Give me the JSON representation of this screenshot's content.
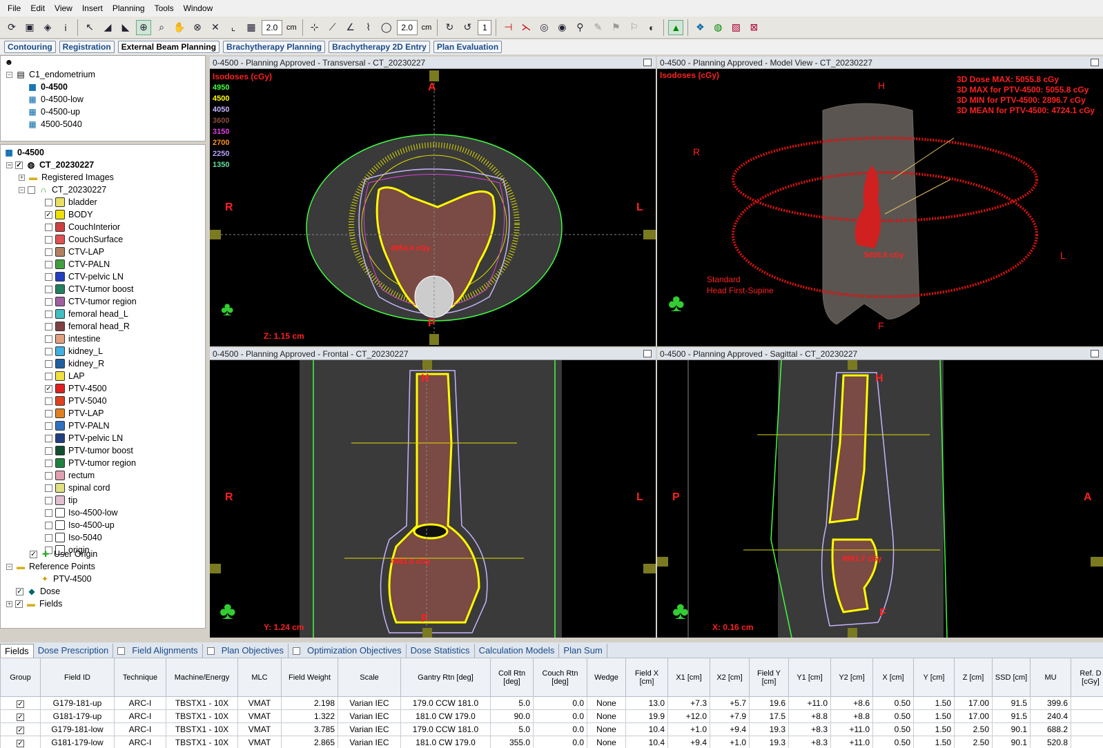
{
  "menu": [
    "File",
    "Edit",
    "View",
    "Insert",
    "Planning",
    "Tools",
    "Window"
  ],
  "toolbar": {
    "zoom_value_1": "2.0",
    "unit_1": "cm",
    "zoom_value_2": "2.0",
    "unit_2": "cm",
    "slice_value": "1"
  },
  "workspace_tabs": [
    "Contouring",
    "Registration",
    "External Beam Planning",
    "Brachytherapy Planning",
    "Brachytherapy 2D Entry",
    "Plan Evaluation"
  ],
  "plan_tree": {
    "course": "C1_endometrium",
    "plans": [
      "0-4500",
      "0-4500-low",
      "0-4500-up",
      "4500-5040"
    ],
    "active_plan": "0-4500"
  },
  "scope_tree": {
    "root": "0-4500",
    "image": "CT_20230227",
    "registered": "Registered Images",
    "structure_set": "CT_20230227",
    "structures": [
      {
        "name": "bladder",
        "checked": false,
        "color": "#e8e060"
      },
      {
        "name": "BODY",
        "checked": true,
        "color": "#f0e000"
      },
      {
        "name": "CouchInterior",
        "checked": false,
        "color": "#d04040"
      },
      {
        "name": "CouchSurface",
        "checked": false,
        "color": "#e05050"
      },
      {
        "name": "CTV-LAP",
        "checked": false,
        "color": "#b08060"
      },
      {
        "name": "CTV-PALN",
        "checked": false,
        "color": "#40a040"
      },
      {
        "name": "CTV-pelvic LN",
        "checked": false,
        "color": "#2040c0"
      },
      {
        "name": "CTV-tumor boost",
        "checked": false,
        "color": "#208060"
      },
      {
        "name": "CTV-tumor region",
        "checked": false,
        "color": "#a060a0"
      },
      {
        "name": "femoral head_L",
        "checked": false,
        "color": "#40c0c0"
      },
      {
        "name": "femoral head_R",
        "checked": false,
        "color": "#804040"
      },
      {
        "name": "intestine",
        "checked": false,
        "color": "#e0a080"
      },
      {
        "name": "kidney_L",
        "checked": false,
        "color": "#40b0e0"
      },
      {
        "name": "kidney_R",
        "checked": false,
        "color": "#2060a0"
      },
      {
        "name": "LAP",
        "checked": false,
        "color": "#f0e040"
      },
      {
        "name": "PTV-4500",
        "checked": true,
        "color": "#e02020"
      },
      {
        "name": "PTV-5040",
        "checked": false,
        "color": "#e04020"
      },
      {
        "name": "PTV-LAP",
        "checked": false,
        "color": "#e08020"
      },
      {
        "name": "PTV-PALN",
        "checked": false,
        "color": "#3070c0"
      },
      {
        "name": "PTV-pelvic LN",
        "checked": false,
        "color": "#204080"
      },
      {
        "name": "PTV-tumor boost",
        "checked": false,
        "color": "#105030"
      },
      {
        "name": "PTV-tumor region",
        "checked": false,
        "color": "#208040"
      },
      {
        "name": "rectum",
        "checked": false,
        "color": "#e0a0b0"
      },
      {
        "name": "spinal cord",
        "checked": false,
        "color": "#e0e080"
      },
      {
        "name": "tip",
        "checked": false,
        "color": "#e0c0d0"
      },
      {
        "name": "Iso-4500-low",
        "checked": false,
        "color": "#ffffff"
      },
      {
        "name": "Iso-4500-up",
        "checked": false,
        "color": "#ffffff"
      },
      {
        "name": "Iso-5040",
        "checked": false,
        "color": "#ffffff"
      },
      {
        "name": "origin",
        "checked": false,
        "color": "#ffffff"
      }
    ],
    "user_origin": "User Origin",
    "reference_points": "Reference Points",
    "ref_point": "PTV-4500",
    "dose": "Dose",
    "fields": "Fields"
  },
  "viewports": {
    "transversal": {
      "title": "0-4500  -  Planning Approved - Transversal - CT_20230227",
      "coord": "Z: 1.15 cm",
      "dose_label": "4954.4 cGy",
      "top": "A",
      "bottom": "P",
      "left": "R",
      "right": "L"
    },
    "model": {
      "title": "0-4500  -  Planning Approved  -  Model View - CT_20230227",
      "top": "H",
      "bottom": "F",
      "left": "R",
      "right": "L",
      "dose_label": "5055.8 cGy",
      "orientation_1": "Standard",
      "orientation_2": "Head First-Supine",
      "stats": [
        "3D Dose MAX: 5055.8 cGy",
        "3D MAX for PTV-4500: 5055.8 cGy",
        "3D MIN for PTV-4500: 2896.7 cGy",
        "3D MEAN for PTV-4500: 4724.1 cGy"
      ]
    },
    "frontal": {
      "title": "0-4500  -  Planning Approved - Frontal - CT_20230227",
      "coord": "Y: 1.24 cm",
      "dose_label": "4961.0 cGy",
      "top": "H",
      "bottom": "F",
      "left": "R",
      "right": "L"
    },
    "sagittal": {
      "title": "0-4500  -  Planning Approved - Sagittal - CT_20230227",
      "coord": "X: 0.16 cm",
      "dose_label": "4991.7 cGy",
      "top": "H",
      "bottom": "F",
      "left": "P",
      "right": "A"
    }
  },
  "isodoses": {
    "title": "Isodoses (cGy)",
    "levels": [
      {
        "value": "4950",
        "color": "#40ff40"
      },
      {
        "value": "4500",
        "color": "#ffff00"
      },
      {
        "value": "4050",
        "color": "#c8b4ff"
      },
      {
        "value": "3600",
        "color": "#8a4a3a"
      },
      {
        "value": "3150",
        "color": "#e040e0"
      },
      {
        "value": "2700",
        "color": "#ff9020"
      },
      {
        "value": "2250",
        "color": "#b4a0ff"
      },
      {
        "value": "1350",
        "color": "#60e0a0"
      }
    ]
  },
  "bottom_tabs": [
    {
      "label": "Fields",
      "check": false,
      "selected": true
    },
    {
      "label": "Dose Prescription",
      "check": false
    },
    {
      "label": "Field Alignments",
      "check": true
    },
    {
      "label": "Plan Objectives",
      "check": true
    },
    {
      "label": "Optimization Objectives",
      "check": true
    },
    {
      "label": "Dose Statistics",
      "check": false
    },
    {
      "label": "Calculation Models",
      "check": false
    },
    {
      "label": "Plan Sum",
      "check": false
    }
  ],
  "field_table": {
    "headers": [
      "Group",
      "Field ID",
      "Technique",
      "Machine/Energy",
      "MLC",
      "Field Weight",
      "Scale",
      "Gantry Rtn [deg]",
      "Coll Rtn [deg]",
      "Couch Rtn [deg]",
      "Wedge",
      "Field X [cm]",
      "X1 [cm]",
      "X2 [cm]",
      "Field Y [cm]",
      "Y1 [cm]",
      "Y2 [cm]",
      "X [cm]",
      "Y [cm]",
      "Z [cm]",
      "SSD [cm]",
      "MU",
      "Ref. D [cGy]"
    ],
    "rows": [
      [
        "✓",
        "G179-181-up",
        "ARC-I",
        "TBSTX1 - 10X",
        "VMAT",
        "2.198",
        "Varian IEC",
        "179.0 CCW 181.0",
        "5.0",
        "0.0",
        "None",
        "13.0",
        "+7.3",
        "+5.7",
        "19.6",
        "+11.0",
        "+8.6",
        "0.50",
        "1.50",
        "17.00",
        "91.5",
        "399.6",
        ""
      ],
      [
        "✓",
        "G181-179-up",
        "ARC-I",
        "TBSTX1 - 10X",
        "VMAT",
        "1.322",
        "Varian IEC",
        "181.0 CW 179.0",
        "90.0",
        "0.0",
        "None",
        "19.9",
        "+12.0",
        "+7.9",
        "17.5",
        "+8.8",
        "+8.8",
        "0.50",
        "1.50",
        "17.00",
        "91.5",
        "240.4",
        ""
      ],
      [
        "✓",
        "G179-181-low",
        "ARC-I",
        "TBSTX1 - 10X",
        "VMAT",
        "3.785",
        "Varian IEC",
        "179.0 CCW 181.0",
        "5.0",
        "0.0",
        "None",
        "10.4",
        "+1.0",
        "+9.4",
        "19.3",
        "+8.3",
        "+11.0",
        "0.50",
        "1.50",
        "2.50",
        "90.1",
        "688.2",
        ""
      ],
      [
        "✓",
        "G181-179-low",
        "ARC-I",
        "TBSTX1 - 10X",
        "VMAT",
        "2.865",
        "Varian IEC",
        "181.0 CW 179.0",
        "355.0",
        "0.0",
        "None",
        "10.4",
        "+9.4",
        "+1.0",
        "19.3",
        "+8.3",
        "+11.0",
        "0.50",
        "1.50",
        "2.50",
        "90.1",
        "520.8",
        ""
      ]
    ]
  }
}
